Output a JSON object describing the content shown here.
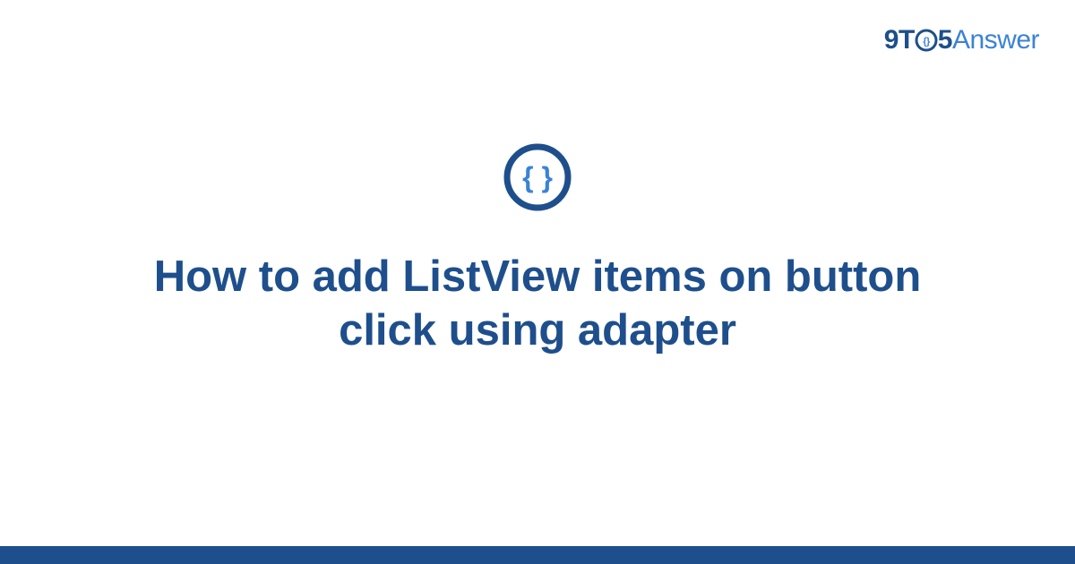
{
  "brand": {
    "digit_9": "9",
    "letter_t": "T",
    "digit_5": "5",
    "answer": "Answer"
  },
  "icon": {
    "name": "code-braces-icon"
  },
  "headline": "How to add ListView items on button click using adapter",
  "colors": {
    "primary": "#1E4F8C",
    "accent": "#3B82D6"
  }
}
